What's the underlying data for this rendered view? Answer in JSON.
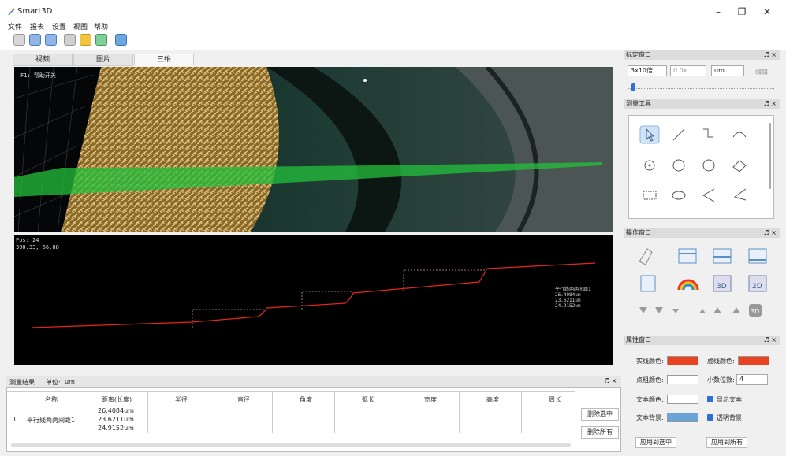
{
  "window": {
    "title": "Smart3D"
  },
  "menu": [
    "文件",
    "报表",
    "设置",
    "视图",
    "帮助"
  ],
  "tabs": [
    "视频",
    "图片",
    "三维"
  ],
  "view3d": {
    "overlay": "F1: 帮助开关"
  },
  "view2d": {
    "fps": "Fps: 24",
    "coords": "390.33, 56.88",
    "annotation": [
      "平行线两两间距1",
      "26.4084um",
      "23.6211um",
      "24.9152um"
    ]
  },
  "results": {
    "title": "测量结果",
    "unit_label": "单位:",
    "unit": "um",
    "columns": [
      "名称",
      "距离(长度)",
      "半径",
      "直径",
      "角度",
      "弧长",
      "宽度",
      "高度",
      "周长"
    ],
    "rows": [
      {
        "index": "1",
        "name": "平行线两两间距1",
        "distances": [
          "26.4084um",
          "23.6211um",
          "24.9152um"
        ]
      }
    ],
    "delete_selected": "删除选中",
    "delete_all": "删除所有"
  },
  "calibration": {
    "title": "标定窗口",
    "magnification": "3x10倍",
    "value": "0.0x",
    "unit": "um",
    "edit": "编辑",
    "slider": 0.02
  },
  "measure_tools": {
    "title": "测量工具"
  },
  "operation": {
    "title": "操作窗口",
    "btn_3d": "3D",
    "btn_2d": "2D"
  },
  "properties": {
    "title": "属性窗口",
    "solid_color_label": "实线颜色:",
    "dash_color_label": "虚线颜色:",
    "point_color_label": "点粗颜色:",
    "decimals_label": "小数位数:",
    "decimals": "4",
    "text_color_label": "文本颜色:",
    "show_text": "显示文本",
    "text_bg_label": "文本背景:",
    "transparent_bg": "透明背景",
    "apply_selected": "应用到选中",
    "apply_all": "应用到所有",
    "colors": {
      "solid": "#e8431e",
      "dash": "#e8431e",
      "point": "#ffffff",
      "text": "#ffffff",
      "text_bg": "#6aa3d8"
    }
  },
  "panel_controls": "♬ ×"
}
